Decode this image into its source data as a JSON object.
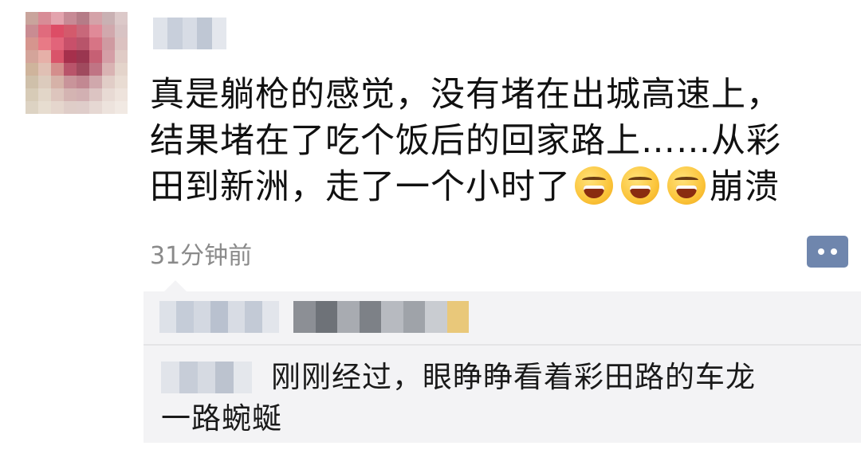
{
  "post": {
    "text_lines": [
      "真是躺枪的感觉，没有堵在出城高速上，",
      "结果堵在了吃个饭后的回家路上……从彩",
      "田到新洲，走了一个小时了",
      "崩溃"
    ],
    "emoji_name": "laughing-crying-emoji",
    "emoji_count": 3,
    "timestamp": "31分钟前"
  },
  "actions": {
    "comment_icon": "comment-bubble-icon"
  },
  "comments": [
    {
      "text_lines": [
        "刚刚经过，眼睁睁看着彩田路的车龙",
        "一路蜿蜒"
      ]
    }
  ],
  "colors": {
    "timestamp": "#8a8a8a",
    "comment_button": "#6f86ad",
    "comment_area_bg": "#f3f3f5"
  }
}
